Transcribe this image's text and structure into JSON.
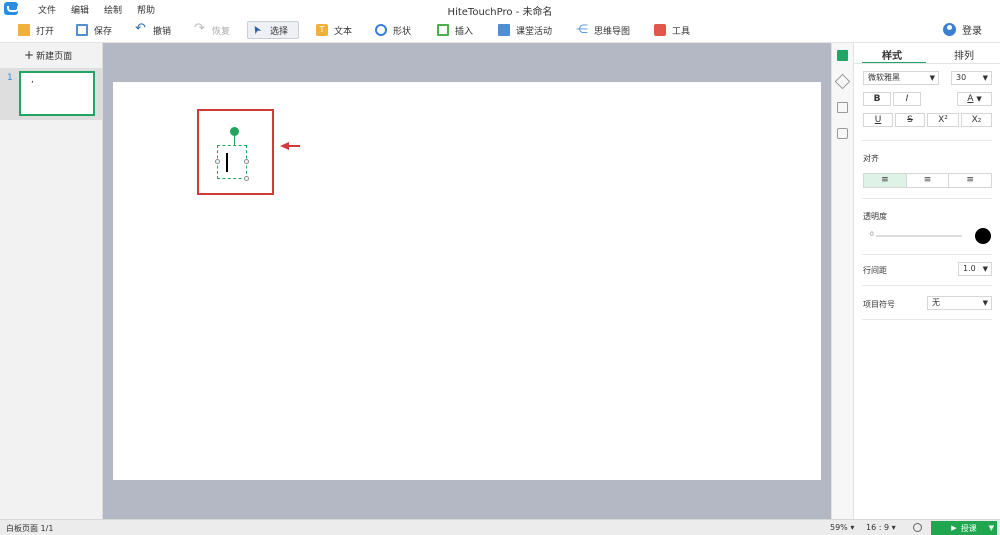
{
  "window": {
    "title": "HiteTouchPro - 未命名"
  },
  "menu": [
    "文件",
    "编辑",
    "绘制",
    "帮助"
  ],
  "toolbar": {
    "open": "打开",
    "save": "保存",
    "undo": "撤销",
    "redo": "恢复",
    "select": "选择",
    "text": "文本",
    "shape": "形状",
    "insert": "插入",
    "class_activity": "课堂活动",
    "mind_map": "思维导图",
    "tools": "工具"
  },
  "account": {
    "login": "登录"
  },
  "left_panel": {
    "new_page": "新建页面",
    "pages": [
      {
        "number": "1",
        "mark": ","
      }
    ]
  },
  "props": {
    "tabs": {
      "style": "样式",
      "arrange": "排列"
    },
    "font_family": "微软雅黑",
    "font_size": "30",
    "format": {
      "bold": "B",
      "italic": "I",
      "font_color": "A",
      "underline": "U",
      "strike": "S",
      "superscript": "X²",
      "subscript": "X₂"
    },
    "align_label": "对齐",
    "align_options": [
      "≡",
      "≡",
      "≡"
    ],
    "opacity_label": "透明度",
    "opacity_value": "0",
    "line_spacing_label": "行间距",
    "line_spacing_value": "1.0",
    "bullet_label": "项目符号",
    "bullet_value": "无",
    "color": "#000000"
  },
  "status": {
    "page": "白板页面 1/1",
    "zoom": "59%",
    "ratio": "16 : 9",
    "lecture": "授课"
  }
}
